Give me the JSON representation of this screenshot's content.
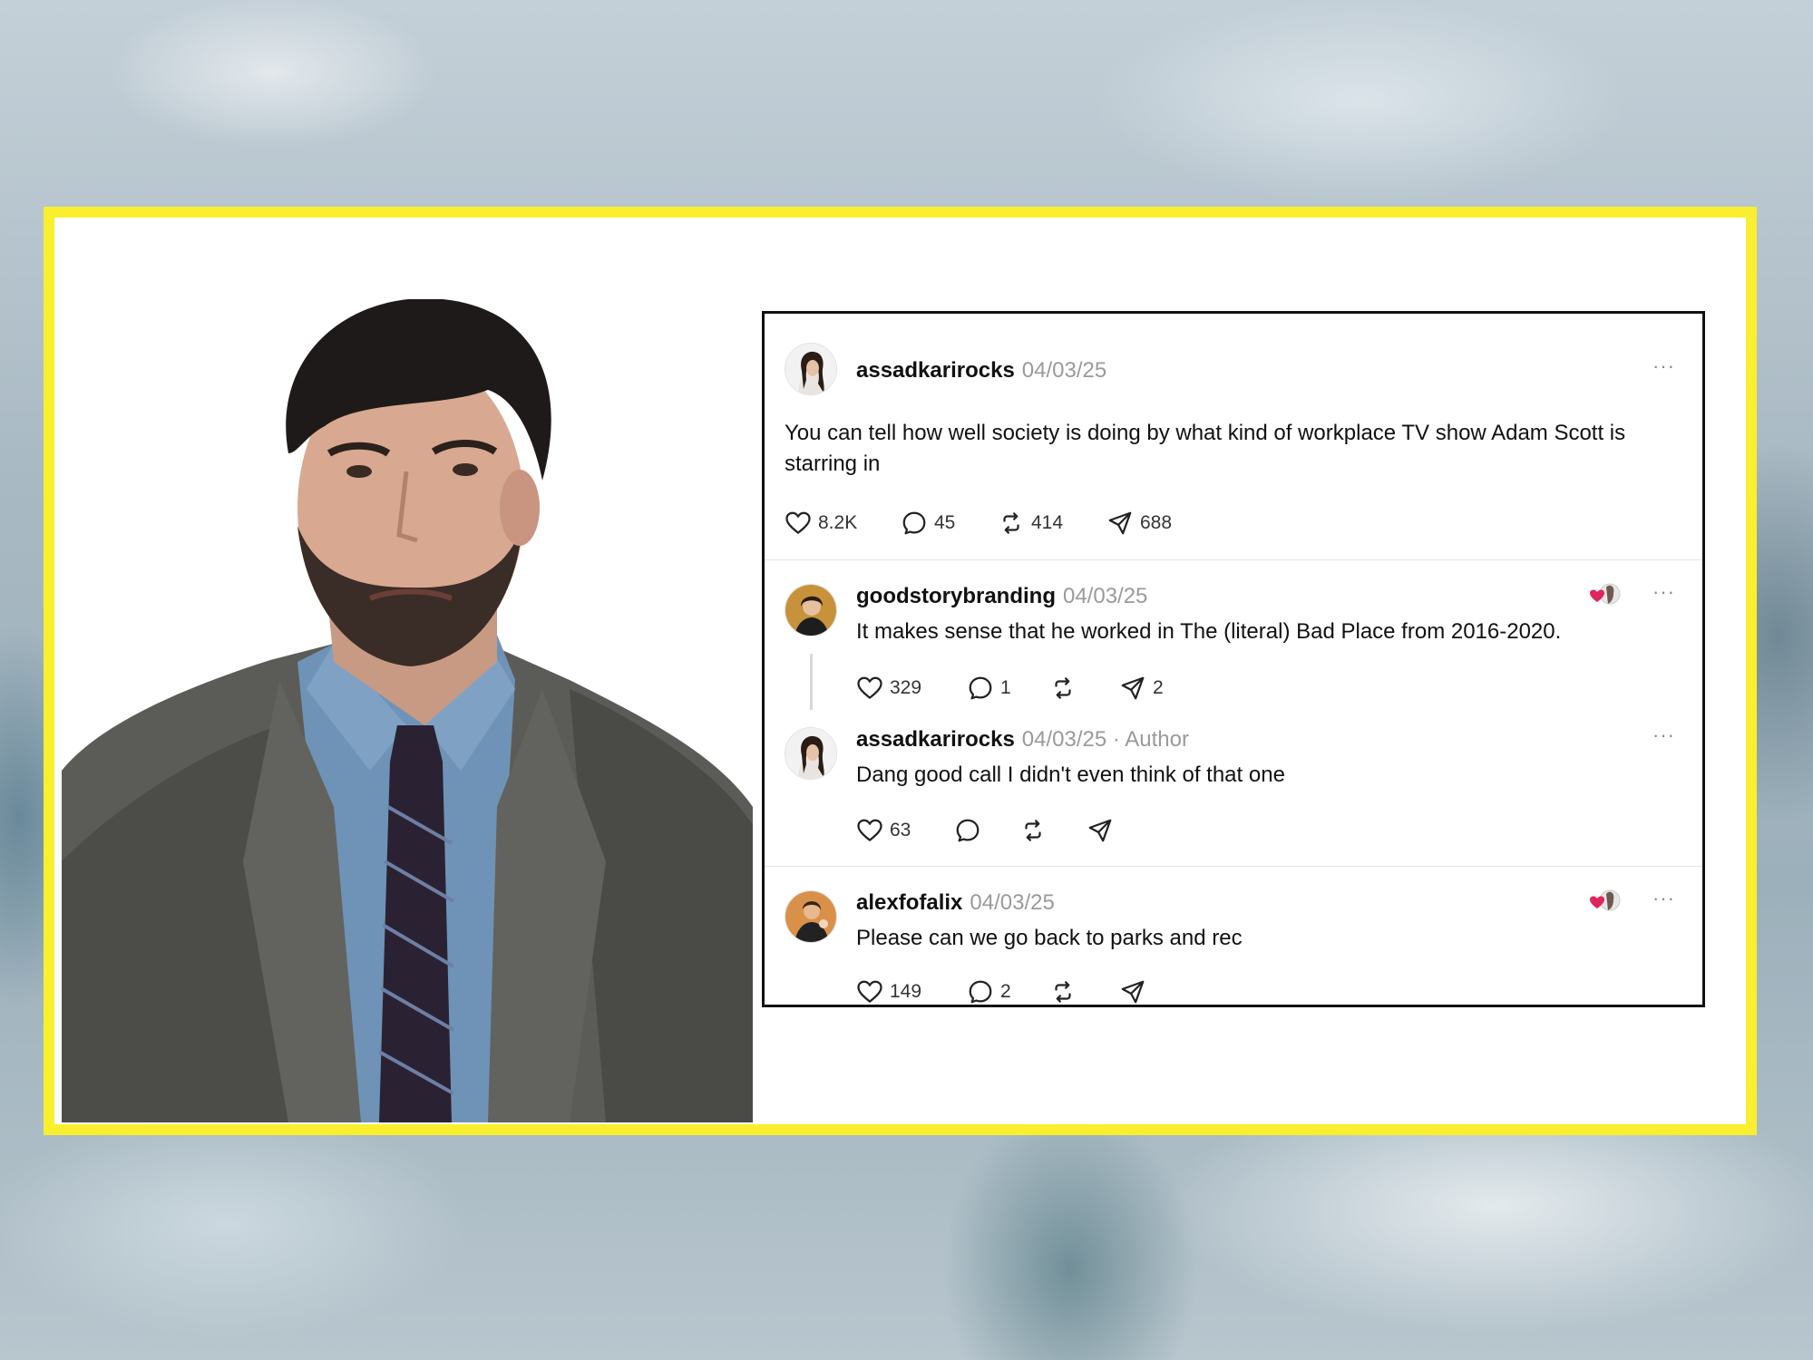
{
  "thread": {
    "main_post": {
      "username": "assadkarirocks",
      "date": "04/03/25",
      "text": "You can tell how well society is doing by what kind of workplace TV show Adam Scott is starring in",
      "likes": "8.2K",
      "replies": "45",
      "reposts": "414",
      "shares": "688"
    },
    "reply_1": {
      "username": "goodstorybranding",
      "date": "04/03/25",
      "text": "It makes sense that he worked in The (literal) Bad Place from 2016-2020.",
      "likes": "329",
      "replies": "1",
      "shares": "2"
    },
    "reply_2": {
      "username": "assadkarirocks",
      "date": "04/03/25",
      "author_tag": "· Author",
      "text": "Dang good call I didn't even think of that one",
      "likes": "63"
    },
    "reply_3": {
      "username": "alexfofalix",
      "date": "04/03/25",
      "text": "Please can we go back to parks and rec",
      "likes": "149",
      "replies": "2"
    },
    "more_label": "···"
  },
  "colors": {
    "frame_border": "#f9ef2e",
    "liked_heart": "#e0245e",
    "meta_text": "#9a9a9a"
  },
  "icons": [
    "heart-icon",
    "comment-icon",
    "repost-icon",
    "share-icon",
    "more-icon"
  ]
}
